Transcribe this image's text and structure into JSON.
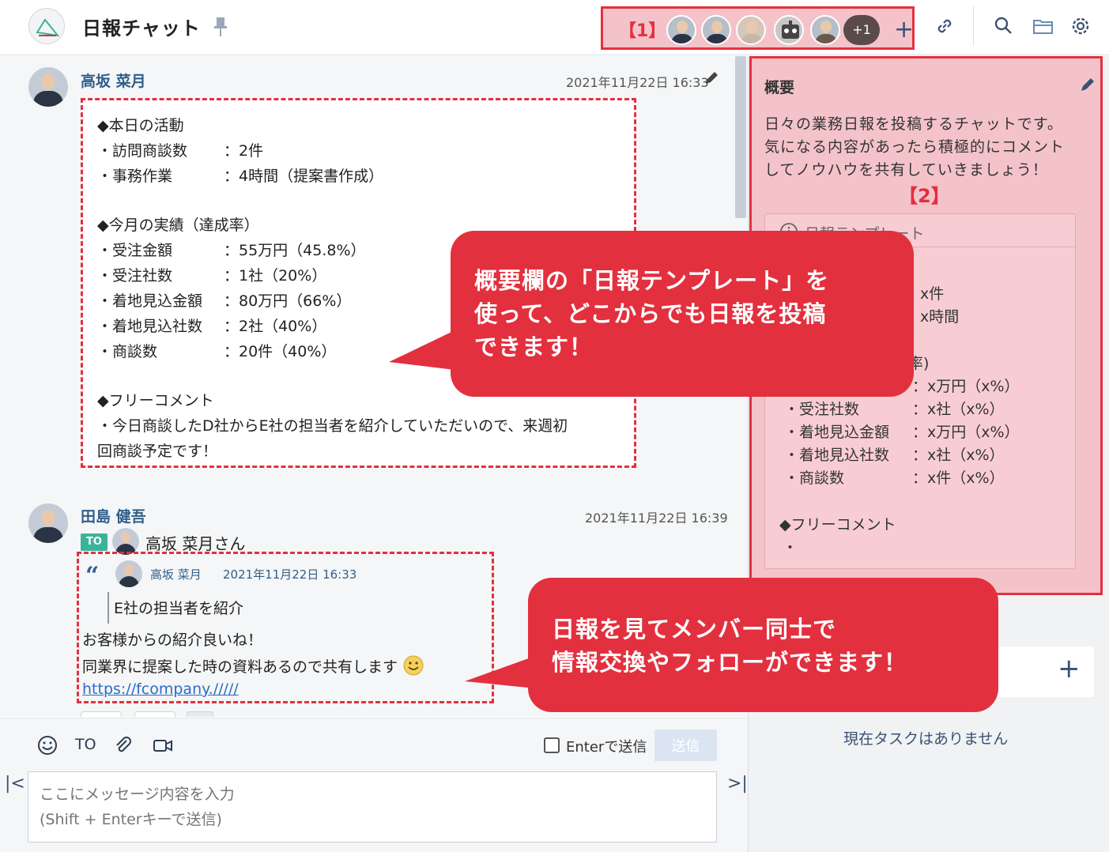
{
  "header": {
    "room_title": "日報チャット",
    "members_tag": "【1】",
    "more_count": "+1"
  },
  "messages": [
    {
      "author": "高坂 菜月",
      "time": "2021年11月22日 16:33",
      "lines": [
        {
          "key": "◆本日の活動",
          "value": ""
        },
        {
          "key": "・訪問商談数",
          "value": "：2件"
        },
        {
          "key": "・事務作業",
          "value": "：4時間（提案書作成）"
        },
        {
          "key": "◆今月の実績（達成率）",
          "value": ""
        },
        {
          "key": "・受注金額",
          "value": "：55万円（45.8%）"
        },
        {
          "key": "・受注社数",
          "value": "：1社（20%）"
        },
        {
          "key": "・着地見込金額",
          "value": "：80万円（66%）"
        },
        {
          "key": "・着地見込社数",
          "value": "：2社（40%）"
        },
        {
          "key": "・商談数",
          "value": "：20件（40%）"
        },
        {
          "key": "◆フリーコメント",
          "value": ""
        },
        {
          "key": "・今日商談したD社からE社の担当者を紹介していただいので、来週初",
          "value": ""
        },
        {
          "key": "回商談予定です！",
          "value": ""
        }
      ]
    },
    {
      "author": "田島 健吾",
      "time": "2021年11月22日 16:39",
      "to_badge": "TO",
      "to_name": "高坂 菜月さん",
      "quote_author": "高坂 菜月",
      "quote_time": "2021年11月22日 16:33",
      "quote_text": "E社の担当者を紹介",
      "reply_lines": [
        "お客様からの紹介良いね！",
        "同業界に提案した時の資料あるので共有します"
      ],
      "link": "https://fcompany./////"
    }
  ],
  "composer": {
    "to_label": "TO",
    "enter_label": "Enterで送信",
    "send_label": "送信",
    "placeholder": "ここにメッセージ内容を入力\n(Shift + Enterキーで送信)",
    "nav_left": "|<",
    "nav_right": ">|"
  },
  "overview": {
    "title": "概要",
    "desc_lines": [
      "日々の業務日報を投稿するチャットです。",
      "気になる内容があったら積極的にコメント",
      "してノウハウを共有していきましょう！"
    ],
    "tag": "【2】",
    "template_label": "日報テンプレート",
    "template_lines": [
      {
        "key": "",
        "value": "x件"
      },
      {
        "key": "",
        "value": "x時間"
      },
      {
        "key": "",
        "value": "成率)"
      },
      {
        "key": "",
        "value": "：x万円（x%）"
      },
      {
        "key": "・受注社数",
        "value": "：x社（x%）"
      },
      {
        "key": "・着地見込金額",
        "value": "：x万円（x%）"
      },
      {
        "key": "・着地見込社数",
        "value": "：x社（x%）"
      },
      {
        "key": "・商談数",
        "value": "：x件（x%）"
      },
      {
        "key": "◆フリーコメント",
        "value": ""
      },
      {
        "key": "・",
        "value": ""
      }
    ]
  },
  "tasks": {
    "empty_label": "現在タスクはありません"
  },
  "callouts": {
    "first": [
      "概要欄の「日報テンプレート」を",
      "使って、どこからでも日報を投稿",
      "できます！"
    ],
    "second": [
      "日報を見てメンバー同士で",
      "情報交換やフォローができます！"
    ]
  },
  "colors": {
    "accent_red": "#e3303f",
    "highlight_pink": "#f4c3ca",
    "link_blue": "#2b6cc8",
    "name_blue": "#2f5f8a"
  }
}
